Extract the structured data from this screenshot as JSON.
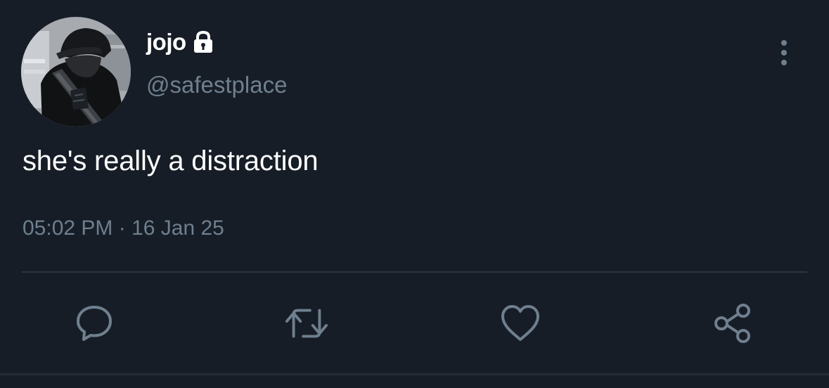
{
  "tweet": {
    "display_name": "jojo",
    "handle": "@safestplace",
    "text": "she's really a distraction",
    "timestamp": "05:02 PM · 16 Jan 25",
    "account_locked": true
  },
  "icons": {
    "lock": "lock-icon",
    "more": "vertical-ellipsis-icon",
    "reply": "speech-bubble-icon",
    "retweet": "retweet-arrows-icon",
    "like": "heart-icon",
    "share": "share-nodes-icon"
  },
  "colors": {
    "background": "#161d27",
    "primary_text": "#ffffff",
    "secondary_text": "#6f7f8e",
    "divider": "#2b3440"
  }
}
